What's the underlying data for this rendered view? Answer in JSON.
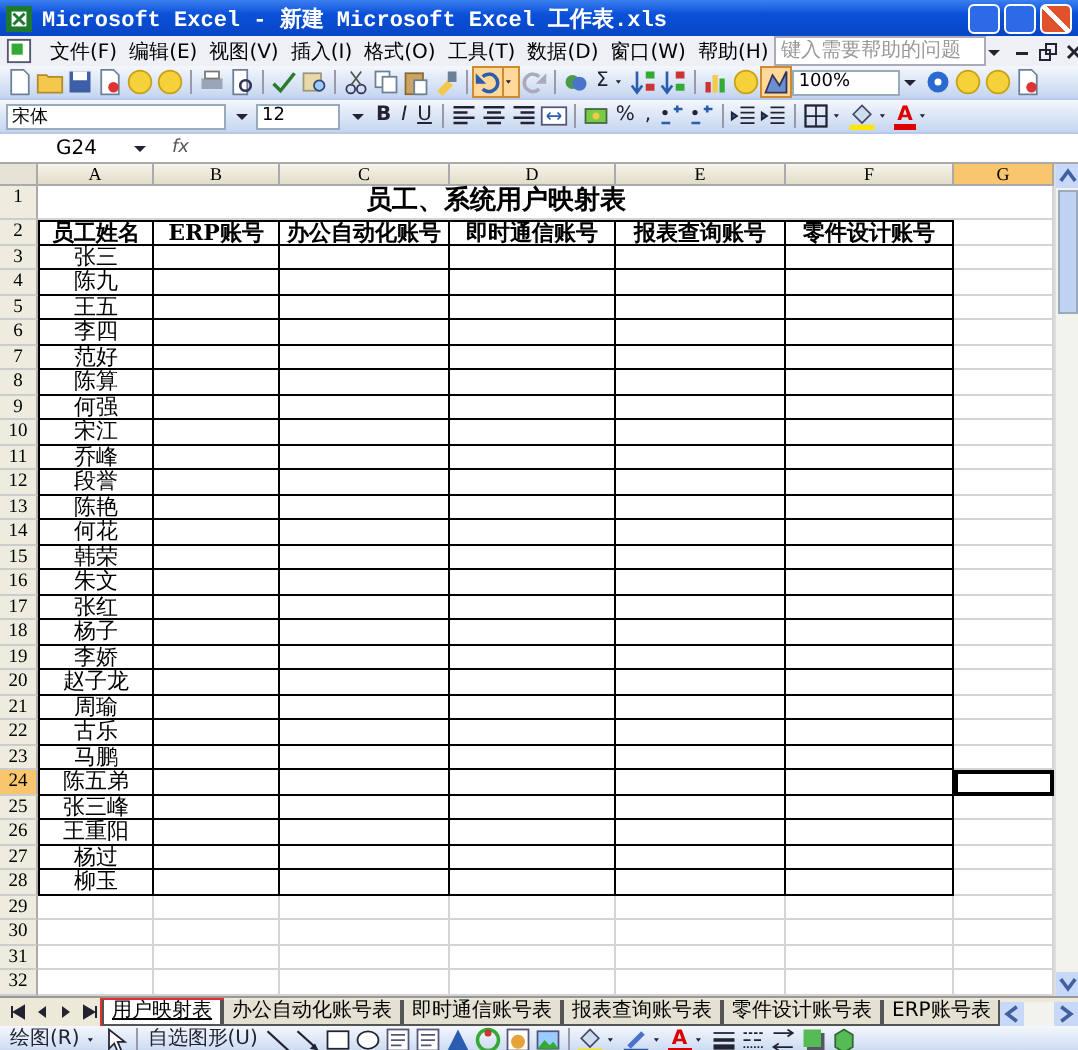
{
  "window": {
    "title": "Microsoft Excel - 新建 Microsoft Excel 工作表.xls"
  },
  "menu": [
    "文件(F)",
    "编辑(E)",
    "视图(V)",
    "插入(I)",
    "格式(O)",
    "工具(T)",
    "数据(D)",
    "窗口(W)",
    "帮助(H)"
  ],
  "help_box": {
    "placeholder": "键入需要帮助的问题"
  },
  "standard_toolbar": {
    "autosum": "Σ",
    "zoom": "100%"
  },
  "format_toolbar": {
    "font": "宋体",
    "size": "12",
    "style_buttons": [
      "B",
      "I",
      "U"
    ],
    "number_buttons": [
      "%",
      ","
    ],
    "font_color": "A"
  },
  "formula_bar": {
    "name_box": "G24",
    "fx": "fx"
  },
  "columns": [
    {
      "letter": "A",
      "selected": false
    },
    {
      "letter": "B",
      "selected": false
    },
    {
      "letter": "C",
      "selected": false
    },
    {
      "letter": "D",
      "selected": false
    },
    {
      "letter": "E",
      "selected": false
    },
    {
      "letter": "F",
      "selected": false
    },
    {
      "letter": "G",
      "selected": true
    }
  ],
  "rows": [
    {
      "num": "1",
      "selected": false,
      "kind": "title",
      "cells": [
        "员工、系统用户映射表"
      ]
    },
    {
      "num": "2",
      "selected": false,
      "kind": "header",
      "cells": [
        "员工姓名",
        "ERP账号",
        "办公自动化账号",
        "即时通信账号",
        "报表查询账号",
        "零件设计账号"
      ]
    },
    {
      "num": "3",
      "selected": false,
      "kind": "data",
      "cells": [
        "张三"
      ]
    },
    {
      "num": "4",
      "selected": false,
      "kind": "data",
      "cells": [
        "陈九"
      ]
    },
    {
      "num": "5",
      "selected": false,
      "kind": "data",
      "cells": [
        "王五"
      ]
    },
    {
      "num": "6",
      "selected": false,
      "kind": "data",
      "cells": [
        "李四"
      ]
    },
    {
      "num": "7",
      "selected": false,
      "kind": "data",
      "cells": [
        "范好"
      ]
    },
    {
      "num": "8",
      "selected": false,
      "kind": "data",
      "cells": [
        "陈算"
      ]
    },
    {
      "num": "9",
      "selected": false,
      "kind": "data",
      "cells": [
        "何强"
      ]
    },
    {
      "num": "10",
      "selected": false,
      "kind": "data",
      "cells": [
        "宋江"
      ]
    },
    {
      "num": "11",
      "selected": false,
      "kind": "data",
      "cells": [
        "乔峰"
      ]
    },
    {
      "num": "12",
      "selected": false,
      "kind": "data",
      "cells": [
        "段誉"
      ]
    },
    {
      "num": "13",
      "selected": false,
      "kind": "data",
      "cells": [
        "陈艳"
      ]
    },
    {
      "num": "14",
      "selected": false,
      "kind": "data",
      "cells": [
        "何花"
      ]
    },
    {
      "num": "15",
      "selected": false,
      "kind": "data",
      "cells": [
        "韩荣"
      ]
    },
    {
      "num": "16",
      "selected": false,
      "kind": "data",
      "cells": [
        "朱文"
      ]
    },
    {
      "num": "17",
      "selected": false,
      "kind": "data",
      "cells": [
        "张红"
      ]
    },
    {
      "num": "18",
      "selected": false,
      "kind": "data",
      "cells": [
        "杨子"
      ]
    },
    {
      "num": "19",
      "selected": false,
      "kind": "data",
      "cells": [
        "李娇"
      ]
    },
    {
      "num": "20",
      "selected": false,
      "kind": "data",
      "cells": [
        "赵子龙"
      ]
    },
    {
      "num": "21",
      "selected": false,
      "kind": "data",
      "cells": [
        "周瑜"
      ]
    },
    {
      "num": "22",
      "selected": false,
      "kind": "data",
      "cells": [
        "古乐"
      ]
    },
    {
      "num": "23",
      "selected": false,
      "kind": "data",
      "cells": [
        "马鹏"
      ]
    },
    {
      "num": "24",
      "selected": true,
      "kind": "data",
      "cells": [
        "陈五弟"
      ]
    },
    {
      "num": "25",
      "selected": false,
      "kind": "data",
      "cells": [
        "张三峰"
      ]
    },
    {
      "num": "26",
      "selected": false,
      "kind": "data",
      "cells": [
        "王重阳"
      ]
    },
    {
      "num": "27",
      "selected": false,
      "kind": "data",
      "cells": [
        "杨过"
      ]
    },
    {
      "num": "28",
      "selected": false,
      "kind": "data",
      "cells": [
        "柳玉"
      ]
    },
    {
      "num": "29",
      "selected": false,
      "kind": "empty"
    },
    {
      "num": "30",
      "selected": false,
      "kind": "empty"
    },
    {
      "num": "31",
      "selected": false,
      "kind": "empty"
    },
    {
      "num": "32",
      "selected": false,
      "kind": "empty"
    }
  ],
  "sheet_tabs": [
    {
      "label": "用户映射表",
      "selected": true
    },
    {
      "label": "办公自动化账号表",
      "selected": false
    },
    {
      "label": "即时通信账号表",
      "selected": false
    },
    {
      "label": "报表查询账号表",
      "selected": false
    },
    {
      "label": "零件设计账号表",
      "selected": false
    },
    {
      "label": "ERP账号表",
      "selected": false
    }
  ],
  "drawing_toolbar": {
    "draw_menu": "绘图(R)",
    "autoshapes_menu": "自选图形(U)",
    "font_color": "A"
  }
}
